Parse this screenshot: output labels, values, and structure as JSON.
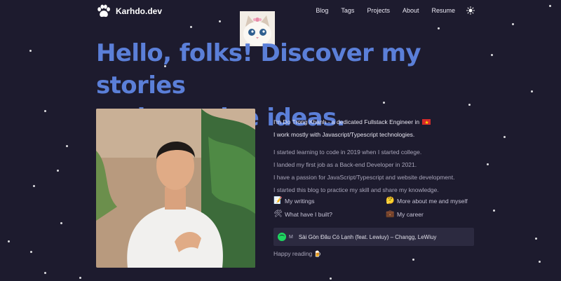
{
  "site": {
    "name": "Karhdo.dev"
  },
  "nav": {
    "items": [
      "Blog",
      "Tags",
      "Projects",
      "About",
      "Resume"
    ],
    "theme_icon": "sun-icon"
  },
  "hero": {
    "line1": "Hello, folks! Discover my stories",
    "line2": "and creative ideas."
  },
  "bio": {
    "intro": "I'm Do Trong Khanh - a dedicated Fullstack Engineer in",
    "intro_flag": "vietnam-flag-icon",
    "stack": "I work mostly with Javascript/Typescript technologies.",
    "p1": "I started learning to code in 2019 when I started college.",
    "p2": "I landed my first job as a Back-end Developer in 2021.",
    "p3": "I have a passion for JavaScript/Typescript and website development.",
    "p4": "I started this blog to practice my skill and share my knowledge."
  },
  "links": {
    "writings": {
      "label": "My writings",
      "icon": "memo-icon"
    },
    "about": {
      "label": "More about me and myself",
      "icon": "thinking-face-icon"
    },
    "built": {
      "label": "What have I built?",
      "icon": "hammer-wrench-icon"
    },
    "career": {
      "label": "My career",
      "icon": "briefcase-icon"
    }
  },
  "spotify": {
    "icon": "spotify-icon",
    "mark": "M",
    "track": "Sài Gòn Đâu Có Lạnh (feat. Lewiuy)",
    "separator": "–",
    "artists": "Changg, LeWiuy"
  },
  "footer": {
    "text": "Happy reading",
    "icon": "beer-icon"
  },
  "colors": {
    "background": "#1d1b2e",
    "accent": "#5b7fd8",
    "spotify": "#1ed760"
  }
}
